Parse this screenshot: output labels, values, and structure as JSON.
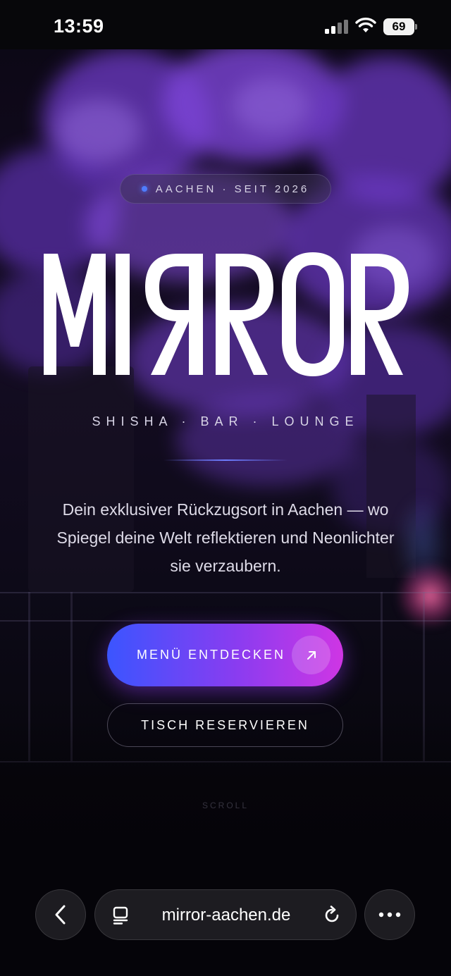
{
  "status_bar": {
    "time": "13:59",
    "battery_level": "69",
    "signal_icon": "cellular-signal-icon",
    "wifi_icon": "wifi-icon",
    "battery_icon": "battery-icon"
  },
  "hero": {
    "location_badge": "AACHEN · SEIT 2026",
    "logo_text": "MIRROR",
    "tagline": "SHISHA · BAR · LOUNGE",
    "description": "Dein exklusiver Rückzugsort in Aachen — wo Spiegel deine Welt reflektieren und Neonlichter sie verzaubern.",
    "primary_button": "MENÜ ENTDECKEN",
    "primary_button_icon": "arrow-up-right-icon",
    "secondary_button": "TISCH RESERVIEREN",
    "scroll_hint": "SCROLL"
  },
  "browser": {
    "url": "mirror-aachen.de",
    "back_icon": "chevron-left-icon",
    "tabs_icon": "tabs-icon",
    "reload_icon": "reload-icon",
    "more_icon": "more-horizontal-icon"
  },
  "colors": {
    "accent_blue": "#3b55ff",
    "accent_magenta": "#cf36e4",
    "blossom_purple": "#7a3fd6"
  }
}
